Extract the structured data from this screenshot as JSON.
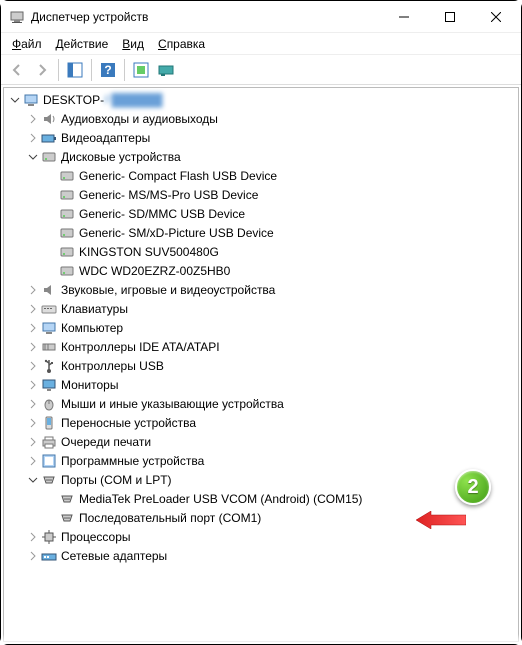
{
  "window": {
    "title": "Диспетчер устройств"
  },
  "menu": {
    "file": "Файл",
    "action": "Действие",
    "view": "Вид",
    "help": "Справка"
  },
  "callout": {
    "number": "2"
  },
  "tree": {
    "root": {
      "label": "DESKTOP-",
      "blurred": "F██████"
    },
    "audio": "Аудиовходы и аудиовыходы",
    "video": "Видеоадаптеры",
    "disk": {
      "label": "Дисковые устройства",
      "items": [
        "Generic- Compact Flash USB Device",
        "Generic- MS/MS-Pro USB Device",
        "Generic- SD/MMC USB Device",
        "Generic- SM/xD-Picture USB Device",
        "KINGSTON SUV500480G",
        "WDC WD20EZRZ-00Z5HB0"
      ]
    },
    "sound": "Звуковые, игровые и видеоустройства",
    "keyboards": "Клавиатуры",
    "computer": "Компьютер",
    "ide": "Контроллеры IDE ATA/ATAPI",
    "usb": "Контроллеры USB",
    "monitors": "Мониторы",
    "mice": "Мыши и иные указывающие устройства",
    "portable": "Переносные устройства",
    "queues": "Очереди печати",
    "software": "Программные устройства",
    "ports": {
      "label": "Порты (COM и LPT)",
      "items": [
        "MediaTek PreLoader USB VCOM (Android) (COM15)",
        "Последовательный порт (COM1)"
      ]
    },
    "cpu": "Процессоры",
    "net": "Сетевые адаптеры"
  }
}
